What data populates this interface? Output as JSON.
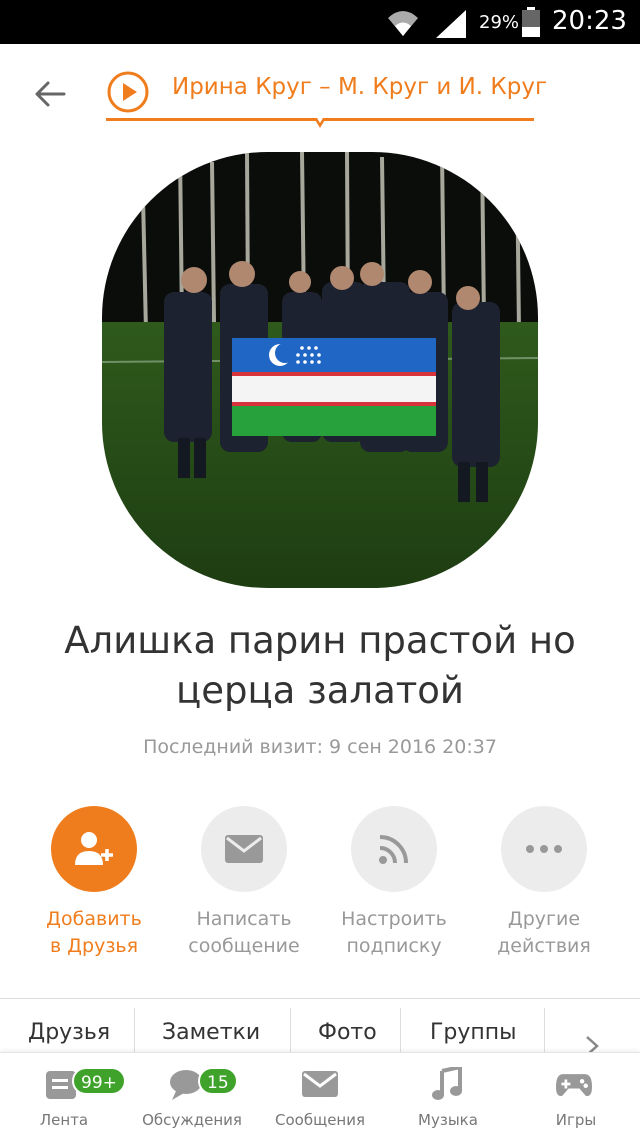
{
  "status_bar": {
    "battery_percent": "29%",
    "time": "20:23"
  },
  "header": {
    "song_title": "Ирина Круг – М. Круг и И. Круг"
  },
  "profile": {
    "name": "Алишка парин прастой но церца залатой",
    "last_visit": "Последний визит: 9 сен 2016 20:37"
  },
  "actions": [
    {
      "label_line1": "Добавить",
      "label_line2": "в Друзья",
      "icon": "add-friend-icon"
    },
    {
      "label_line1": "Написать",
      "label_line2": "сообщение",
      "icon": "mail-icon"
    },
    {
      "label_line1": "Настроить",
      "label_line2": "подписку",
      "icon": "feed-icon"
    },
    {
      "label_line1": "Другие",
      "label_line2": "действия",
      "icon": "more-icon"
    }
  ],
  "tabs": [
    "Друзья",
    "Заметки",
    "Фото",
    "Группы"
  ],
  "bottom_nav": [
    {
      "label": "Лента",
      "badge": "99+",
      "icon": "feed-list-icon"
    },
    {
      "label": "Обсуждения",
      "badge": "15",
      "icon": "discussions-icon"
    },
    {
      "label": "Сообщения",
      "badge": "",
      "icon": "envelope-icon"
    },
    {
      "label": "Музыка",
      "badge": "",
      "icon": "music-note-icon"
    },
    {
      "label": "Игры",
      "badge": "",
      "icon": "gamepad-icon"
    }
  ],
  "colors": {
    "accent": "#f07d1d",
    "badge": "#3fa32b",
    "muted": "#999999"
  }
}
